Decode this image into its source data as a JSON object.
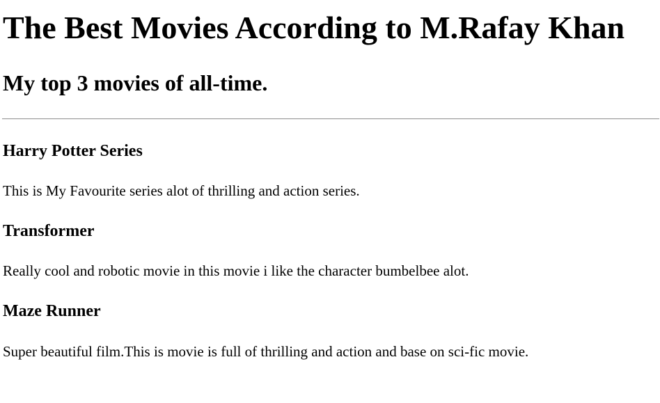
{
  "page": {
    "title": "The Best Movies According to M.Rafay Khan",
    "subtitle": "My top 3 movies of all-time."
  },
  "movies": [
    {
      "title": "Harry Potter Series",
      "description": "This is My Favourite series alot of thrilling and action series."
    },
    {
      "title": "Transformer",
      "description": "Really cool and robotic movie in this movie i like the character bumbelbee alot."
    },
    {
      "title": "Maze Runner",
      "description": "Super beautiful film.This is movie is full of thrilling and action and base on sci-fic movie."
    }
  ]
}
